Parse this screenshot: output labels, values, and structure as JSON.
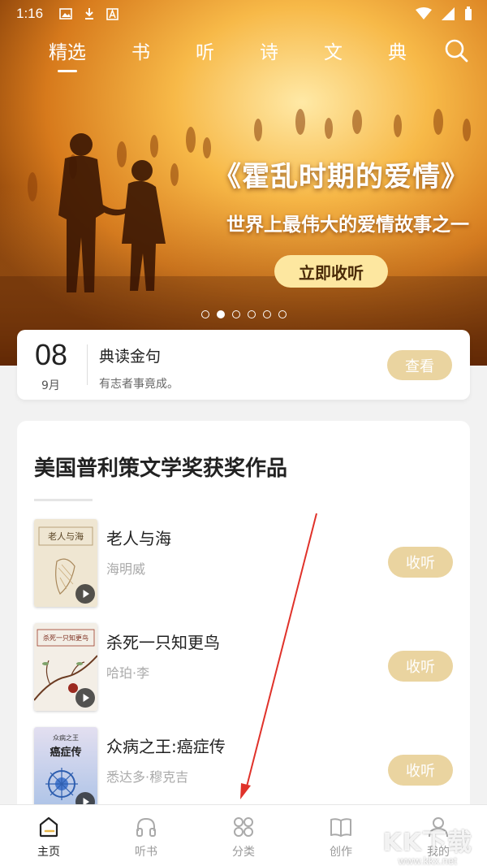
{
  "status_bar": {
    "time": "1:16",
    "left_icons": [
      "image-icon",
      "download-icon",
      "a-box-icon"
    ],
    "right_icons": [
      "wifi-icon",
      "signal-icon",
      "battery-icon"
    ]
  },
  "top_nav": {
    "tabs": [
      {
        "label": "精选",
        "active": true
      },
      {
        "label": "书",
        "active": false
      },
      {
        "label": "听",
        "active": false
      },
      {
        "label": "诗",
        "active": false
      },
      {
        "label": "文",
        "active": false
      },
      {
        "label": "典",
        "active": false
      }
    ],
    "search_icon": "search-icon"
  },
  "hero": {
    "title": "《霍乱时期的爱情》",
    "subtitle": "世界上最伟大的爱情故事之一",
    "cta": "立即收听",
    "slide_count": 6,
    "active_slide": 2,
    "colors": {
      "glow": "#f7c35a",
      "deep": "#a8520c",
      "cta_bg": "#fde7a0"
    }
  },
  "daily": {
    "day": "08",
    "month": "9月",
    "title": "典读金句",
    "text": "有志者事竟成。",
    "button": "查看"
  },
  "section": {
    "title": "美国普利策文学奖获奖作品",
    "books": [
      {
        "title": "老人与海",
        "author": "海明威",
        "button": "收听",
        "cover_text": "老人与海"
      },
      {
        "title": "杀死一只知更鸟",
        "author": "哈珀·李",
        "button": "收听",
        "cover_text": "杀死一只知更鸟"
      },
      {
        "title": "众病之王:癌症传",
        "author": "悉达多·穆克吉",
        "button": "收听",
        "cover_text_top": "众病之王",
        "cover_text": "癌症传"
      }
    ]
  },
  "bottom_nav": {
    "items": [
      {
        "label": "主页",
        "icon": "home-icon",
        "active": true
      },
      {
        "label": "听书",
        "icon": "headphones-icon",
        "active": false
      },
      {
        "label": "分类",
        "icon": "grid-icon",
        "active": false
      },
      {
        "label": "创作",
        "icon": "book-icon",
        "active": false
      },
      {
        "label": "我的",
        "icon": "profile-icon",
        "active": false
      }
    ]
  },
  "watermark": {
    "main": "KK下载",
    "url": "www.kkx.net"
  },
  "colors": {
    "accent_button": "#ead4a0",
    "annotation_arrow": "#e0322a"
  }
}
